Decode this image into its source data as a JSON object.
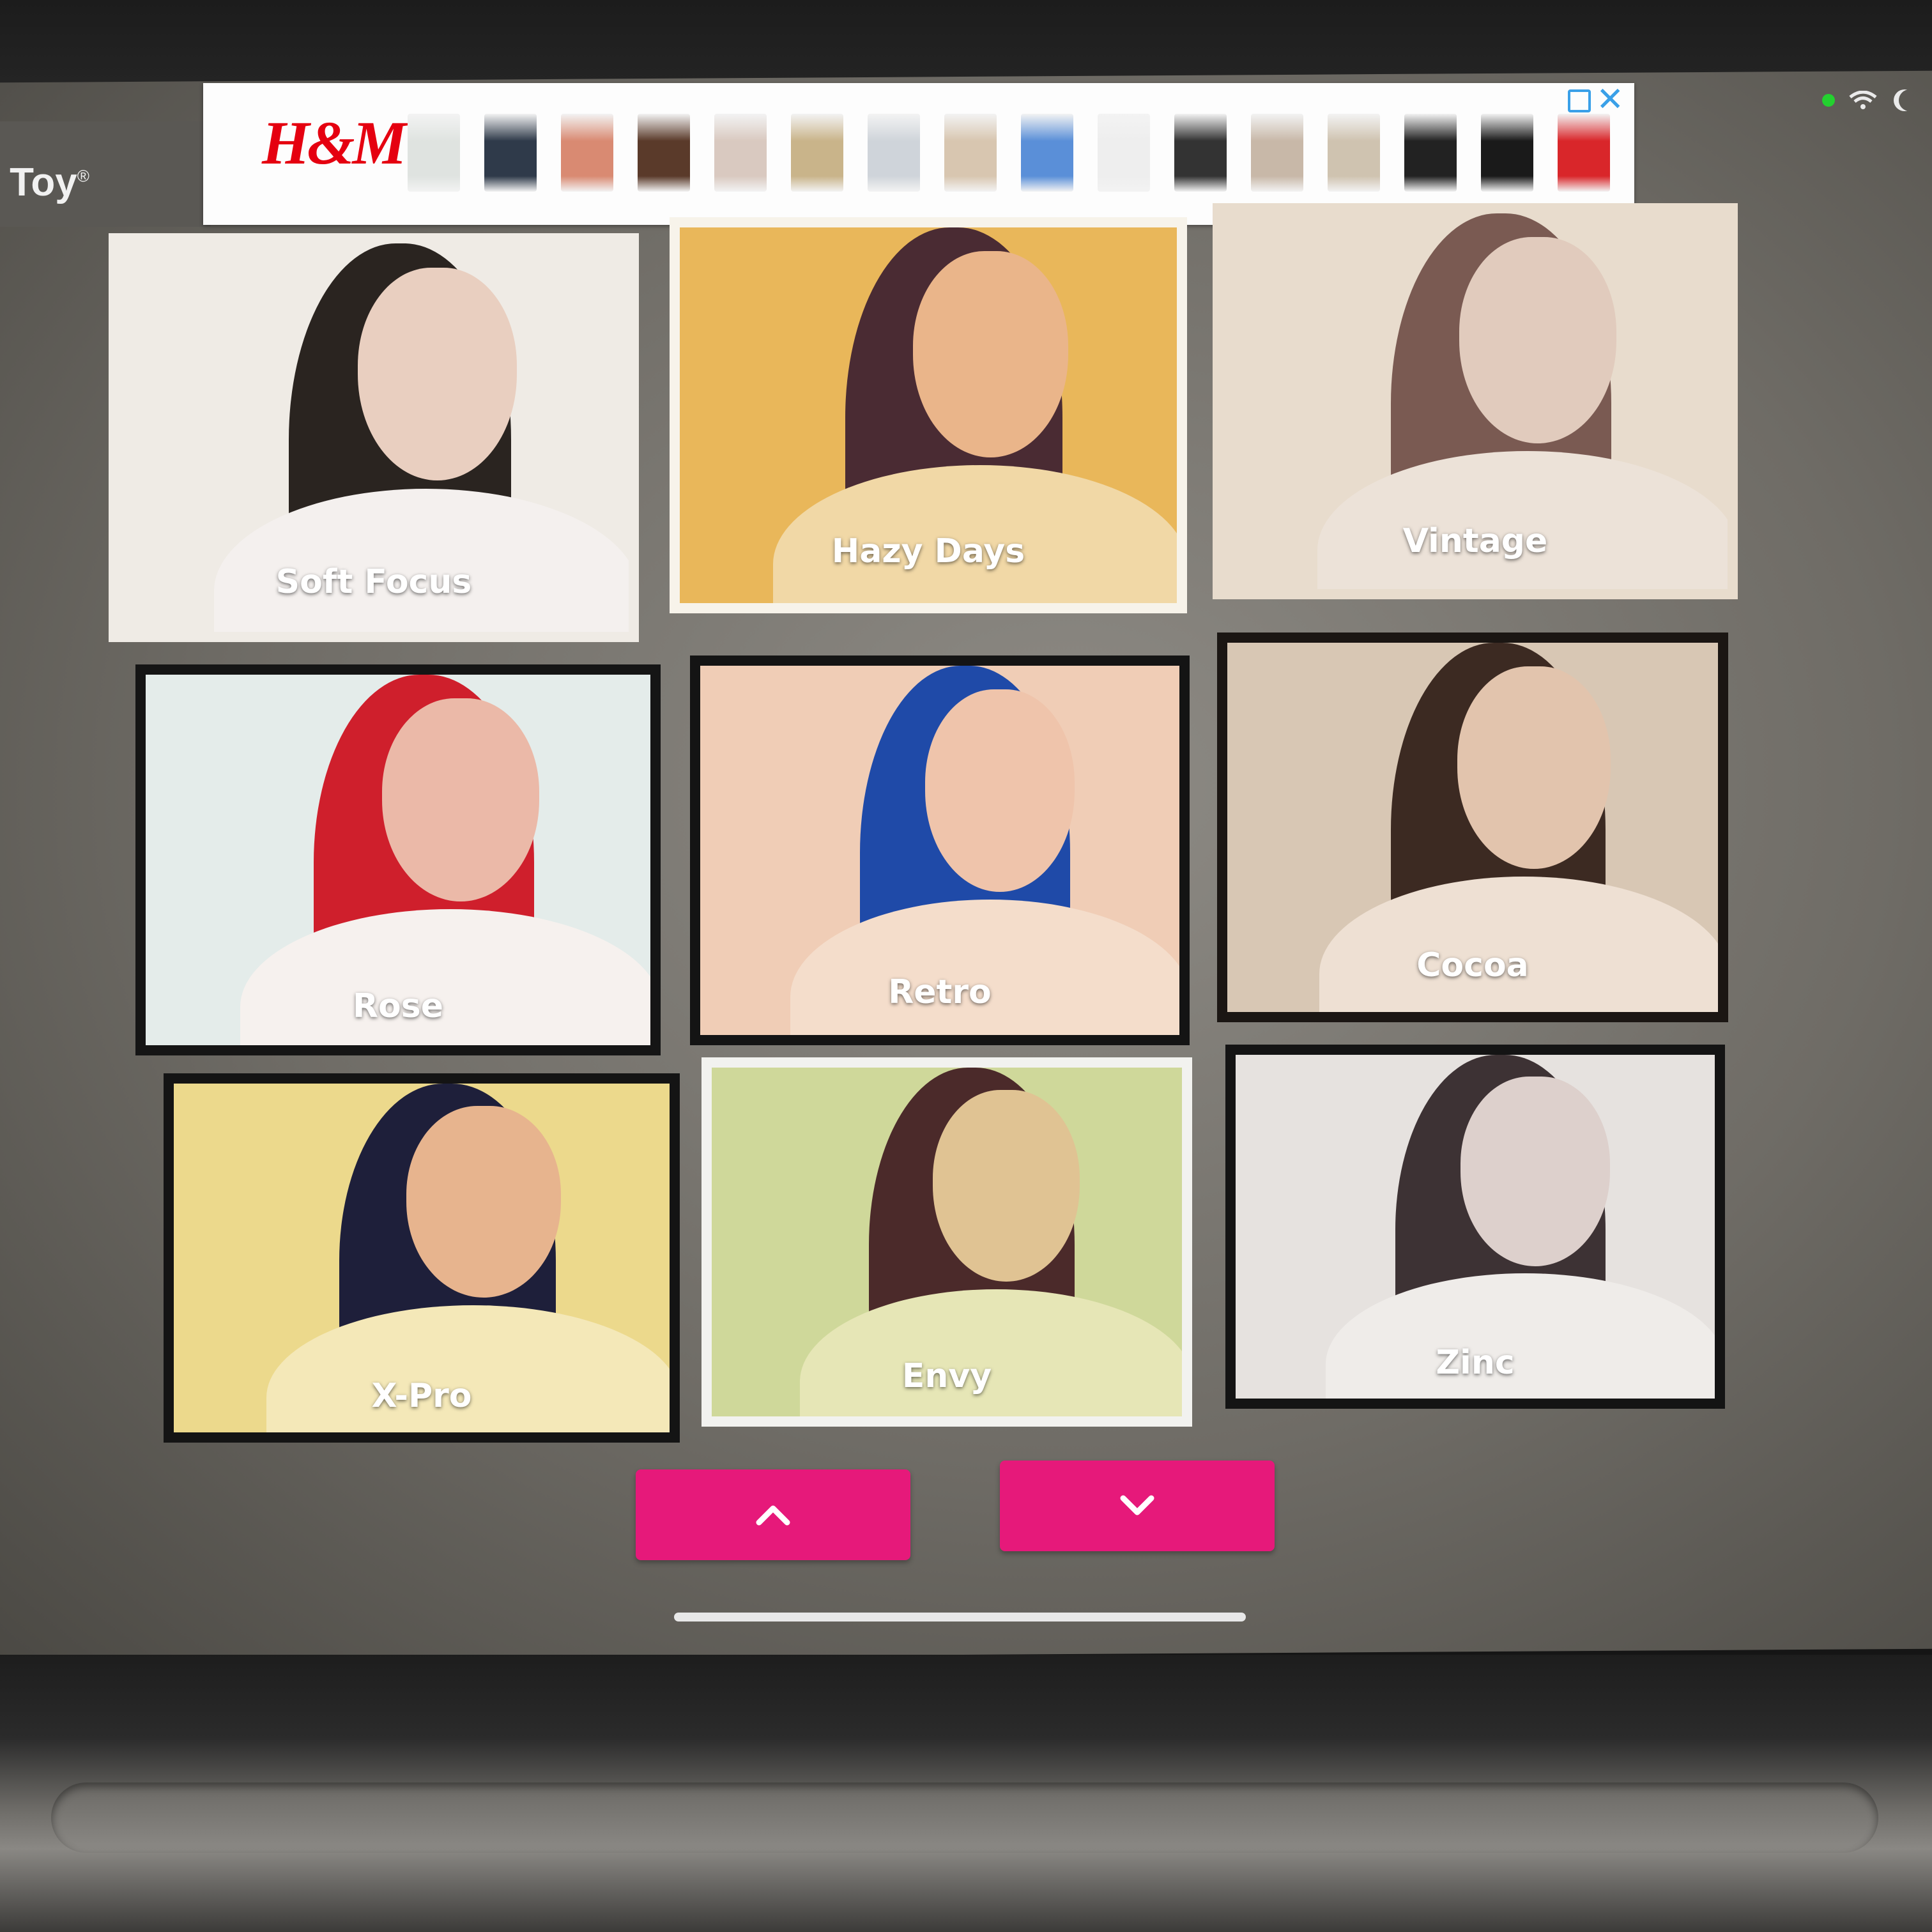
{
  "app": {
    "title": "n Toy",
    "trademark": "®"
  },
  "ad": {
    "brand": "H&M",
    "choices_icon": "adchoices-icon",
    "close_label": "✕",
    "product_colors": [
      "#dfe3e0",
      "#2f3a4a",
      "#d98a72",
      "#5a3a2a",
      "#d9c9c0",
      "#c9b48a",
      "#cfd4da",
      "#d8c6b0",
      "#5a8fd8",
      "#eeeeee",
      "#333333",
      "#c8b8a8",
      "#cfc3b0",
      "#222222",
      "#1a1a1a",
      "#d9262a"
    ]
  },
  "status": {
    "indicator_color": "#23d12f",
    "icons": [
      "wifi-icon",
      "moon-icon"
    ]
  },
  "filters": [
    {
      "name": "Soft Focus",
      "bg": "#efebe5",
      "hair": "#2a2420",
      "face": "#e9cfc0",
      "shirt": "#f4f0ee",
      "frame": "#efebe5"
    },
    {
      "name": "Hazy Days",
      "bg": "#e9b75a",
      "hair": "#4a2b33",
      "face": "#eab58a",
      "shirt": "#f1d8a6",
      "frame": "#f7f3ea"
    },
    {
      "name": "Vintage",
      "bg": "#e8dccd",
      "hair": "#7a5a52",
      "face": "#e1cbbd",
      "shirt": "#ece2d8",
      "frame": "#e8dccd"
    },
    {
      "name": "Rose",
      "bg": "#e4ecea",
      "hair": "#cf1f2c",
      "face": "#ebb9a8",
      "shirt": "#f6f1ee",
      "frame": "#151515"
    },
    {
      "name": "Retro",
      "bg": "#f0cdb6",
      "hair": "#1f4aa8",
      "face": "#efc4ab",
      "shirt": "#f4ddcb",
      "frame": "#141414"
    },
    {
      "name": "Cocoa",
      "bg": "#d8c7b4",
      "hair": "#3c2a22",
      "face": "#e2c4ad",
      "shirt": "#eee0d3",
      "frame": "#1b1613"
    },
    {
      "name": "X-Pro",
      "bg": "#ecd98c",
      "hair": "#1e1f3a",
      "face": "#e7b48e",
      "shirt": "#f4e8b8",
      "frame": "#141414"
    },
    {
      "name": "Envy",
      "bg": "#cfd89a",
      "hair": "#4b2a2a",
      "face": "#e0c393",
      "shirt": "#e6e6b6",
      "frame": "#f2f2ef"
    },
    {
      "name": "Zinc",
      "bg": "#e6e2df",
      "hair": "#3d3234",
      "face": "#ddd0cc",
      "shirt": "#efece9",
      "frame": "#141414"
    }
  ],
  "navigation": {
    "up_label": "^",
    "down_label": "⌄",
    "button_color": "#e6197a"
  }
}
